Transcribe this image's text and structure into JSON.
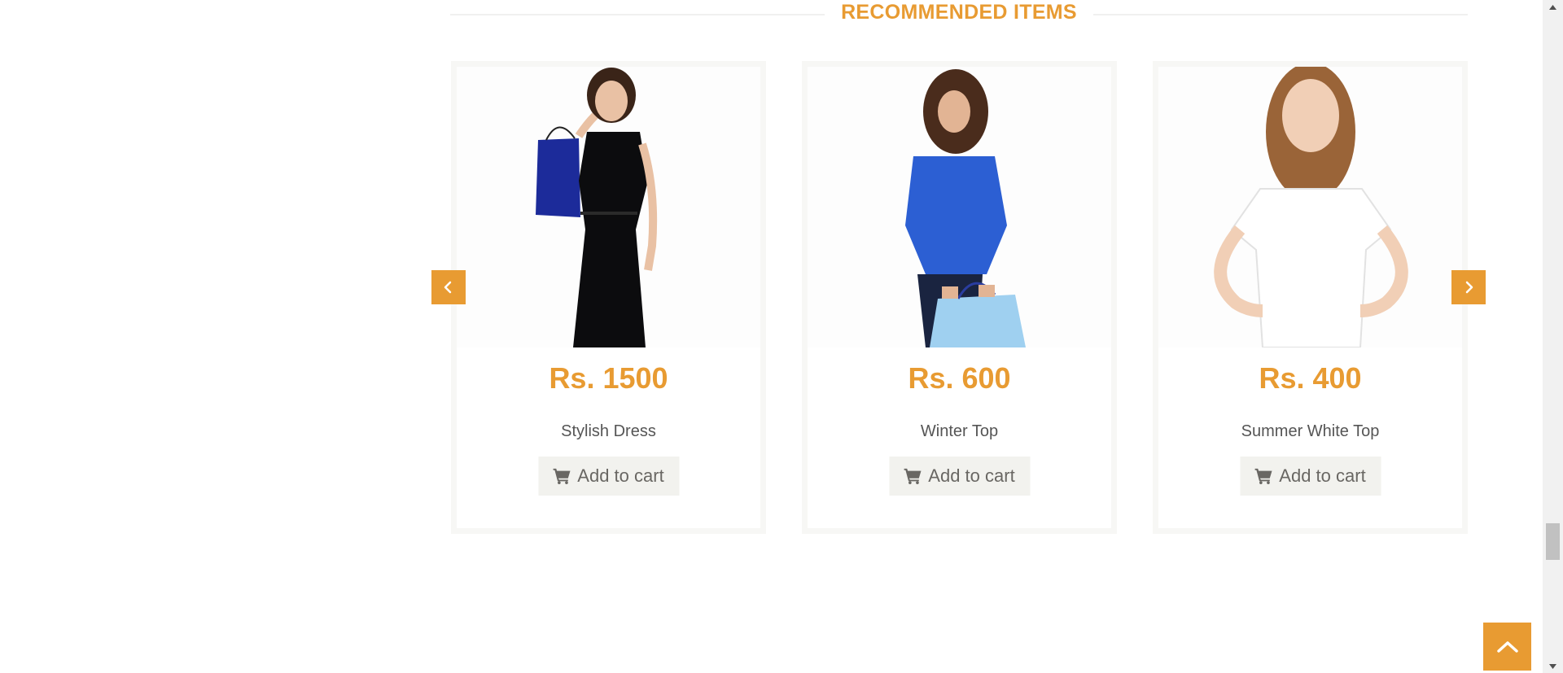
{
  "section": {
    "title": "RECOMMENDED ITEMS"
  },
  "products": [
    {
      "price": "Rs. 1500",
      "name": "Stylish Dress",
      "cta": "Add to cart",
      "image": "woman-black-dress-shopping-bag"
    },
    {
      "price": "Rs. 600",
      "name": "Winter Top",
      "cta": "Add to cart",
      "image": "woman-blue-top-shopping-bag"
    },
    {
      "price": "Rs. 400",
      "name": "Summer White Top",
      "cta": "Add to cart",
      "image": "woman-white-tshirt"
    }
  ],
  "icons": {
    "prev": "chevron-left-icon",
    "next": "chevron-right-icon",
    "cart": "shopping-cart-icon",
    "scroll_top": "chevron-up-icon"
  },
  "colors": {
    "accent": "#e89b32",
    "button_bg": "#f2f2ee",
    "button_text": "#696763",
    "name_text": "#555555"
  }
}
